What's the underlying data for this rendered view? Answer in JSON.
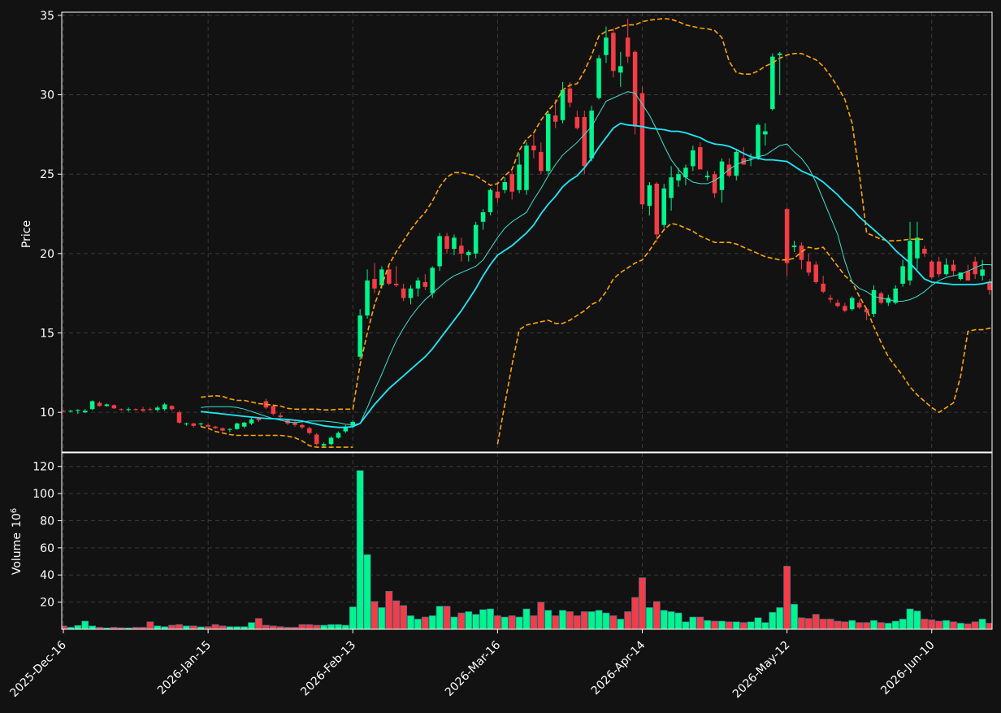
{
  "colors": {
    "background": "#121212",
    "up": "#00f58c",
    "down": "#f23d46",
    "bollinger": "#ffa500",
    "ma_fast": "#40e0d0",
    "ma_slow": "#1ee8f8",
    "grid": "#3a3a3a",
    "axis": "#ffffff"
  },
  "chart_data": {
    "type": "candlestick",
    "panels": {
      "price": {
        "ylabel": "Price",
        "ylim": [
          7.5,
          35.2
        ],
        "yticks": [
          10,
          15,
          20,
          25,
          30,
          35
        ]
      },
      "volume": {
        "ylabel": "Volume",
        "ylabel_exponent": "10^6",
        "ylim": [
          0,
          130
        ],
        "yticks": [
          20,
          40,
          60,
          80,
          100,
          120
        ]
      }
    },
    "x_tick_labels": [
      "2025-Dec-16",
      "2026-Jan-15",
      "2026-Feb-13",
      "2026-Mar-16",
      "2026-Apr-14",
      "2026-May-12",
      "2026-Jun-10"
    ],
    "x_tick_indices": [
      0,
      20,
      40,
      60,
      80,
      100,
      120
    ],
    "grid": true,
    "ohlcv": [
      [
        10.1,
        10.15,
        10.0,
        10.05,
        2.5
      ],
      [
        10.05,
        10.15,
        10.0,
        10.1,
        1.5
      ],
      [
        10.1,
        10.2,
        9.9,
        10.15,
        2.8
      ],
      [
        10.0,
        10.2,
        9.95,
        10.1,
        6
      ],
      [
        10.2,
        10.75,
        10.15,
        10.7,
        2.5
      ],
      [
        10.6,
        10.7,
        10.35,
        10.4,
        1.5
      ],
      [
        10.4,
        10.55,
        10.35,
        10.5,
        1
      ],
      [
        10.45,
        10.5,
        10.2,
        10.25,
        1.5
      ],
      [
        10.2,
        10.25,
        10.1,
        10.15,
        1.2
      ],
      [
        10.15,
        10.3,
        10.05,
        10.2,
        1
      ],
      [
        10.2,
        10.25,
        10.1,
        10.15,
        1.5
      ],
      [
        10.2,
        10.35,
        10.05,
        10.1,
        1.5
      ],
      [
        10.2,
        10.3,
        10.1,
        10.15,
        5.5
      ],
      [
        10.15,
        10.4,
        10.05,
        10.3,
        2.5
      ],
      [
        10.2,
        10.6,
        10.1,
        10.5,
        2
      ],
      [
        10.4,
        10.45,
        10.1,
        10.2,
        3
      ],
      [
        10.0,
        10.1,
        9.3,
        9.35,
        3.5
      ],
      [
        9.25,
        9.35,
        9.15,
        9.3,
        2.5
      ],
      [
        9.3,
        9.35,
        9.05,
        9.15,
        2.5
      ],
      [
        9.25,
        9.35,
        9.1,
        9.3,
        1.8
      ],
      [
        9.2,
        9.25,
        9.05,
        9.1,
        2
      ],
      [
        9.1,
        9.15,
        8.95,
        9.0,
        3.5
      ],
      [
        9.0,
        9.05,
        8.8,
        8.85,
        2.5
      ],
      [
        8.9,
        9.0,
        8.75,
        8.95,
        2
      ],
      [
        8.95,
        9.35,
        8.9,
        9.3,
        2
      ],
      [
        9.1,
        9.4,
        9.0,
        9.35,
        2
      ],
      [
        9.3,
        9.65,
        9.2,
        9.55,
        5
      ],
      [
        9.6,
        9.7,
        9.4,
        9.5,
        8
      ],
      [
        10.7,
        10.85,
        10.2,
        10.3,
        3
      ],
      [
        10.4,
        10.5,
        9.8,
        9.9,
        2.5
      ],
      [
        9.8,
        10.0,
        9.65,
        9.7,
        2
      ],
      [
        9.5,
        9.6,
        9.2,
        9.3,
        1.5
      ],
      [
        9.35,
        9.45,
        9.1,
        9.2,
        1.5
      ],
      [
        9.2,
        9.3,
        8.95,
        9.05,
        3.5
      ],
      [
        9.0,
        9.1,
        8.6,
        8.7,
        3.5
      ],
      [
        8.6,
        8.7,
        7.9,
        8.0,
        3
      ],
      [
        7.9,
        8.1,
        7.75,
        8.0,
        3
      ],
      [
        8.0,
        8.5,
        7.9,
        8.4,
        3.5
      ],
      [
        8.4,
        8.8,
        8.35,
        8.7,
        3.5
      ],
      [
        8.8,
        9.2,
        8.7,
        9.1,
        3
      ],
      [
        9.15,
        9.5,
        9.0,
        9.4,
        16.5
      ],
      [
        13.5,
        16.5,
        13.3,
        16.1,
        117
      ],
      [
        16.1,
        19.0,
        15.9,
        18.3,
        55
      ],
      [
        18.4,
        19.4,
        17.5,
        17.8,
        20.5
      ],
      [
        18.0,
        19.2,
        17.8,
        19.0,
        16
      ],
      [
        19.0,
        19.3,
        18.0,
        18.1,
        28
      ],
      [
        18.1,
        19.2,
        17.9,
        18.0,
        21
      ],
      [
        17.8,
        18.1,
        17.0,
        17.2,
        17.5
      ],
      [
        17.2,
        18.0,
        16.8,
        17.8,
        10
      ],
      [
        17.8,
        18.5,
        17.3,
        18.3,
        7.5
      ],
      [
        18.2,
        18.7,
        17.7,
        17.9,
        9
      ],
      [
        17.5,
        19.2,
        17.2,
        19.1,
        10
      ],
      [
        19.2,
        21.3,
        18.9,
        21.1,
        17
      ],
      [
        21.1,
        21.3,
        20.0,
        20.3,
        17
      ],
      [
        20.3,
        21.2,
        19.9,
        21.0,
        9
      ],
      [
        20.5,
        21.0,
        19.5,
        20.0,
        12
      ],
      [
        19.9,
        20.2,
        19.5,
        20.1,
        13
      ],
      [
        20.0,
        22.0,
        19.7,
        21.8,
        11
      ],
      [
        22.0,
        22.8,
        21.5,
        22.6,
        14.5
      ],
      [
        22.6,
        24.1,
        22.4,
        24.0,
        15
      ],
      [
        23.9,
        24.5,
        23.2,
        23.5,
        10
      ],
      [
        24.0,
        24.8,
        23.8,
        24.5,
        9
      ],
      [
        25.0,
        25.2,
        23.4,
        23.9,
        10
      ],
      [
        24.0,
        26.3,
        23.8,
        25.6,
        9
      ],
      [
        24.0,
        27.0,
        23.7,
        26.8,
        15
      ],
      [
        26.8,
        27.5,
        26.0,
        26.5,
        10
      ],
      [
        26.4,
        27.0,
        25.0,
        25.2,
        20
      ],
      [
        25.2,
        29.0,
        25.0,
        28.8,
        14
      ],
      [
        28.7,
        29.7,
        27.9,
        28.3,
        10
      ],
      [
        28.4,
        30.8,
        28.2,
        30.3,
        14
      ],
      [
        30.4,
        30.8,
        29.2,
        29.5,
        13
      ],
      [
        28.6,
        29.0,
        27.8,
        27.9,
        10
      ],
      [
        28.6,
        29.0,
        25.0,
        25.5,
        13
      ],
      [
        26.0,
        29.3,
        25.8,
        29.0,
        13
      ],
      [
        29.8,
        32.5,
        29.7,
        32.3,
        14
      ],
      [
        32.5,
        34.3,
        32.0,
        33.6,
        12
      ],
      [
        33.9,
        34.2,
        31.1,
        31.5,
        10
      ],
      [
        31.4,
        32.7,
        30.5,
        31.8,
        7.5
      ],
      [
        33.6,
        34.8,
        32.0,
        32.4,
        13
      ],
      [
        32.7,
        32.8,
        27.5,
        28.0,
        23.5
      ],
      [
        30.1,
        30.5,
        22.8,
        23.1,
        38
      ],
      [
        23.0,
        24.5,
        22.4,
        24.3,
        16
      ],
      [
        24.4,
        24.5,
        20.7,
        21.2,
        20.5
      ],
      [
        21.8,
        24.4,
        21.6,
        24.1,
        14
      ],
      [
        23.5,
        25.5,
        22.7,
        24.8,
        13
      ],
      [
        24.6,
        25.4,
        24.2,
        25.0,
        12
      ],
      [
        24.8,
        25.6,
        24.3,
        25.4,
        5.5
      ],
      [
        25.5,
        26.8,
        25.2,
        26.5,
        9
      ],
      [
        26.7,
        27.0,
        25.5,
        25.3,
        9
      ],
      [
        24.8,
        25.2,
        24.6,
        24.9,
        6.5
      ],
      [
        25.0,
        25.2,
        23.5,
        23.8,
        6
      ],
      [
        24.0,
        26.0,
        23.2,
        25.8,
        6
      ],
      [
        25.6,
        26.0,
        24.8,
        24.9,
        5.5
      ],
      [
        24.9,
        26.6,
        24.6,
        26.4,
        5.5
      ],
      [
        26.0,
        26.7,
        25.7,
        25.6,
        5
      ],
      [
        26.0,
        26.3,
        25.5,
        26.0,
        5.5
      ],
      [
        26.0,
        28.2,
        25.9,
        28.1,
        8.5
      ],
      [
        27.5,
        28.2,
        26.8,
        27.7,
        5
      ],
      [
        29.1,
        32.6,
        29.0,
        32.4,
        12.5
      ],
      [
        32.5,
        32.7,
        30.0,
        32.6,
        16
      ],
      [
        22.8,
        22.9,
        18.6,
        19.4,
        46.5
      ],
      [
        20.4,
        20.8,
        20.1,
        20.5,
        18.5
      ],
      [
        20.5,
        20.7,
        19.0,
        19.6,
        8.5
      ],
      [
        19.5,
        20.0,
        18.6,
        18.8,
        8
      ],
      [
        19.3,
        19.5,
        18.1,
        18.2,
        11
      ],
      [
        18.1,
        18.6,
        17.5,
        17.6,
        7.5
      ],
      [
        17.2,
        17.4,
        16.9,
        17.1,
        7.5
      ],
      [
        16.9,
        17.1,
        16.6,
        16.7,
        6
      ],
      [
        16.7,
        16.9,
        16.3,
        16.4,
        5.5
      ],
      [
        16.5,
        17.3,
        16.4,
        17.2,
        6.5
      ],
      [
        16.9,
        17.1,
        16.5,
        16.6,
        5
      ],
      [
        16.5,
        16.6,
        15.8,
        16.3,
        5
      ],
      [
        16.2,
        18.0,
        16.0,
        17.7,
        6.5
      ],
      [
        17.5,
        17.6,
        16.8,
        16.9,
        5
      ],
      [
        16.9,
        17.4,
        16.7,
        17.2,
        4.5
      ],
      [
        16.9,
        18.0,
        16.8,
        17.8,
        6
      ],
      [
        18.1,
        19.6,
        17.9,
        19.2,
        7.5
      ],
      [
        18.3,
        22.0,
        18.0,
        20.8,
        15
      ],
      [
        19.7,
        22.0,
        19.0,
        21.0,
        13.5
      ],
      [
        20.3,
        20.5,
        19.8,
        20.0,
        7.5
      ],
      [
        19.5,
        19.6,
        18.4,
        18.5,
        7
      ],
      [
        19.5,
        19.8,
        18.5,
        18.7,
        6
      ],
      [
        18.7,
        19.7,
        18.6,
        19.3,
        6.5
      ],
      [
        19.3,
        19.6,
        18.6,
        18.9,
        5.5
      ],
      [
        18.4,
        18.8,
        18.3,
        18.8,
        4.5
      ],
      [
        18.9,
        19.3,
        18.5,
        18.3,
        4
      ],
      [
        19.5,
        19.8,
        18.4,
        18.7,
        5.5
      ],
      [
        18.6,
        19.6,
        18.3,
        19.0,
        7.5
      ],
      [
        18.2,
        18.4,
        17.4,
        17.7,
        4.5
      ]
    ],
    "bollinger_upper": [
      null,
      null,
      null,
      null,
      null,
      null,
      null,
      null,
      null,
      null,
      null,
      null,
      null,
      null,
      null,
      null,
      null,
      null,
      null,
      10.95,
      11.0,
      11.05,
      11.0,
      10.85,
      10.75,
      10.75,
      10.65,
      10.55,
      10.5,
      10.45,
      10.4,
      10.25,
      10.2,
      10.2,
      10.2,
      10.2,
      10.15,
      10.15,
      10.2,
      10.2,
      10.2,
      13.0,
      15.0,
      16.8,
      18.0,
      19.3,
      20.1,
      20.8,
      21.5,
      22.1,
      22.6,
      23.3,
      24.2,
      24.8,
      25.1,
      25.1,
      25.0,
      24.9,
      24.6,
      24.3,
      24.4,
      24.9,
      25.3,
      26.5,
      27.2,
      27.6,
      28.4,
      29.0,
      29.5,
      30.3,
      30.6,
      30.7,
      31.5,
      32.5,
      33.7,
      34.0,
      34.1,
      34.3,
      34.4,
      34.4,
      34.6,
      34.7,
      34.75,
      34.8,
      34.75,
      34.6,
      34.4,
      34.3,
      34.2,
      34.15,
      34.05,
      33.6,
      32.1,
      31.4,
      31.3,
      31.3,
      31.5,
      31.8,
      32.0,
      32.3,
      32.5,
      32.6,
      32.6,
      32.4,
      32.2,
      31.8,
      31.2,
      30.5,
      29.7,
      28.2,
      25.0,
      21.3,
      21.1,
      20.9,
      20.8,
      20.8,
      20.85,
      20.9,
      20.9,
      20.9
    ],
    "bollinger_lower": [
      null,
      null,
      null,
      null,
      null,
      null,
      null,
      null,
      null,
      null,
      null,
      null,
      null,
      null,
      null,
      null,
      null,
      null,
      null,
      9.1,
      9.0,
      8.8,
      8.7,
      8.6,
      8.55,
      8.55,
      8.55,
      8.55,
      8.55,
      8.55,
      8.55,
      8.5,
      8.4,
      8.2,
      7.9,
      7.8,
      7.8,
      7.8,
      7.8,
      7.8,
      7.8,
      null,
      null,
      null,
      null,
      null,
      null,
      null,
      null,
      null,
      null,
      null,
      null,
      null,
      null,
      null,
      null,
      null,
      null,
      null,
      8.0,
      10.5,
      13.0,
      15.2,
      15.5,
      15.6,
      15.7,
      15.8,
      15.6,
      15.6,
      15.8,
      16.1,
      16.4,
      16.8,
      17.0,
      17.6,
      18.4,
      18.8,
      19.1,
      19.4,
      19.6,
      20.2,
      20.9,
      21.5,
      21.9,
      21.8,
      21.6,
      21.4,
      21.1,
      20.9,
      20.7,
      20.7,
      20.7,
      20.6,
      20.4,
      20.2,
      20.0,
      19.8,
      19.7,
      19.6,
      19.6,
      19.7,
      20.1,
      20.4,
      20.3,
      20.4,
      19.8,
      19.2,
      18.6,
      18.2,
      17.3,
      16.5,
      15.4,
      14.4,
      13.5,
      12.9,
      12.3,
      11.6,
      11.1,
      10.7,
      10.3,
      10.0,
      10.3,
      10.6,
      12.3,
      15.1,
      15.2,
      15.2,
      15.3,
      15.3
    ],
    "ma_fast": [
      null,
      null,
      null,
      null,
      null,
      null,
      null,
      null,
      null,
      null,
      null,
      null,
      null,
      null,
      null,
      null,
      null,
      null,
      null,
      10.3,
      10.35,
      10.35,
      10.35,
      10.35,
      10.3,
      10.2,
      10.05,
      9.9,
      9.75,
      9.6,
      9.5,
      9.4,
      9.35,
      9.4,
      9.45,
      9.45,
      9.45,
      9.4,
      9.35,
      9.25,
      9.2,
      9.3,
      10.3,
      11.4,
      12.4,
      13.5,
      14.5,
      15.3,
      16.0,
      16.6,
      17.1,
      17.5,
      17.9,
      18.3,
      18.6,
      18.8,
      19.0,
      19.2,
      19.6,
      20.3,
      21.0,
      21.6,
      22.0,
      22.3,
      22.6,
      23.4,
      24.1,
      24.9,
      25.6,
      26.2,
      26.6,
      27.0,
      27.5,
      28.0,
      28.8,
      29.6,
      29.8,
      30.0,
      30.2,
      30.1,
      29.4,
      28.7,
      27.8,
      26.8,
      25.9,
      25.3,
      24.8,
      24.5,
      24.4,
      24.4,
      24.6,
      24.9,
      25.3,
      25.6,
      25.8,
      25.9,
      26.1,
      26.2,
      26.5,
      26.8,
      26.9,
      26.4,
      26.0,
      25.4,
      24.5,
      23.4,
      22.3,
      21.2,
      19.5,
      18.2,
      17.8,
      17.6,
      17.3,
      17.2,
      17.1,
      17.0,
      17.0,
      17.1,
      17.3,
      17.6,
      18.0,
      18.3,
      18.5,
      18.6,
      18.7,
      18.9,
      19.1,
      19.3,
      19.3,
      19.2
    ],
    "ma_slow": [
      null,
      null,
      null,
      null,
      null,
      null,
      null,
      null,
      null,
      null,
      null,
      null,
      null,
      null,
      null,
      null,
      null,
      null,
      null,
      10.05,
      10.0,
      9.95,
      9.9,
      9.85,
      9.8,
      9.75,
      9.7,
      9.65,
      9.62,
      9.6,
      9.58,
      9.55,
      9.5,
      9.45,
      9.35,
      9.25,
      9.15,
      9.1,
      9.05,
      9.05,
      9.1,
      9.3,
      9.9,
      10.5,
      11.0,
      11.5,
      11.9,
      12.3,
      12.7,
      13.1,
      13.5,
      14.0,
      14.6,
      15.2,
      15.8,
      16.4,
      17.1,
      17.8,
      18.6,
      19.3,
      19.9,
      20.2,
      20.5,
      20.9,
      21.3,
      21.8,
      22.5,
      23.1,
      23.6,
      24.2,
      24.6,
      24.9,
      25.4,
      26.0,
      26.7,
      27.3,
      27.9,
      28.2,
      28.1,
      28.05,
      28.0,
      27.9,
      27.85,
      27.8,
      27.7,
      27.7,
      27.6,
      27.45,
      27.3,
      27.05,
      26.9,
      26.85,
      26.75,
      26.55,
      26.3,
      26.1,
      26.0,
      25.9,
      25.9,
      25.85,
      25.8,
      25.5,
      25.2,
      25.0,
      24.8,
      24.5,
      24.1,
      23.7,
      23.2,
      22.8,
      22.3,
      21.9,
      21.5,
      21.1,
      20.7,
      20.2,
      19.8,
      19.4,
      18.9,
      18.4,
      18.2,
      18.15,
      18.1,
      18.05,
      18.05,
      18.05,
      18.05,
      18.1,
      18.2,
      18.2
    ]
  }
}
